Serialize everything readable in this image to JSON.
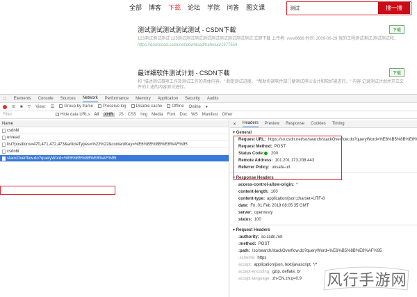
{
  "site": {
    "nav": [
      "全部",
      "博客",
      "下载",
      "论坛",
      "学院",
      "问答",
      "图文课"
    ],
    "nav_active_index": 2,
    "search_value": "测试",
    "search_button": "搜一搜",
    "results": [
      {
        "title": "测试测试测试测试测试 - CSDN下载",
        "snippet": "123测试测试测试 123测试测试测试测试测试测试测试测试测试 立即下载 上传者: vvvv6666 时间: 2009-06-29 我的工程测试测试,测试测试和..",
        "url": "https://download.csdn.net/download/haheiuo/1977654",
        "badge": "下载"
      },
      {
        "title": "最详细软件测试计划 - CSDN下载",
        "snippet": "和 \"描述测试事项工作及测试工作的具体内容。\" 制定测试进度。 \"帮助协调软件部门便测试得以设计和较好被进行。\" 内容 记录测试计划并开立文件的上述的内容测试进行。",
        "url": "",
        "badge": "下载"
      }
    ]
  },
  "devtools": {
    "tabs": [
      "Elements",
      "Console",
      "Sources",
      "Network",
      "Performance",
      "Memory",
      "Application",
      "Security",
      "Audits"
    ],
    "active_tab": "Network",
    "toolbar": {
      "view": "View:",
      "group_by_frame": "Group by frame",
      "preserve_log": "Preserve log",
      "disable_cache": "Disable cache",
      "offline": "Offline",
      "online": "Online"
    },
    "filter": {
      "placeholder": "Filter",
      "hide_data_urls": "Hide data URLs",
      "types": [
        "All",
        "XHR",
        "JS",
        "CSS",
        "Img",
        "Media",
        "Font",
        "Doc",
        "WS",
        "Manifest",
        "Other"
      ],
      "selected_type": "XHR"
    },
    "list_header": "Name",
    "requests": [
      "csdnbi",
      "unread",
      "list?positions=470,471,472,473&articleTypes=%22%22&contentKey=%E6%B5%8B%E8%AF%95",
      "csdnbi",
      "stackOverflow.do?queryWord=%E6%B5%8B%E8%AF%95"
    ],
    "selected_request_index": 4,
    "detail_tabs": [
      "Headers",
      "Preview",
      "Response",
      "Cookies",
      "Timing"
    ],
    "active_detail_tab": "Headers",
    "general": {
      "title": "General",
      "rows": [
        {
          "k": "Request URL:",
          "v": "https://so.csdn.net/so/search/stackOverflow.do?queryWord=%E6%B5%8B%E8%AF%95"
        },
        {
          "k": "Request Method:",
          "v": "POST"
        },
        {
          "k": "Status Code:",
          "v": "200"
        },
        {
          "k": "Remote Address:",
          "v": "101.201.173.208:443"
        },
        {
          "k": "Referrer Policy:",
          "v": "unsafe-url"
        }
      ]
    },
    "response_headers": {
      "title": "Response Headers",
      "rows": [
        {
          "k": "access-control-allow-origin:",
          "v": "*"
        },
        {
          "k": "content-length:",
          "v": "100"
        },
        {
          "k": "content-type:",
          "v": "application/json;charset=UTF-8"
        },
        {
          "k": "date:",
          "v": "Fri, 01 Feb 2019 08:05:35 GMT"
        },
        {
          "k": "server:",
          "v": "openresty"
        },
        {
          "k": "status:",
          "v": "100"
        }
      ]
    },
    "request_headers": {
      "title": "Request Headers",
      "rows": [
        {
          "k": ":authority:",
          "v": "so.csdn.net"
        },
        {
          "k": ":method:",
          "v": "POST"
        },
        {
          "k": ":path:",
          "v": "/so/search/stackOverflow.do?queryWord=%E6%B5%8B%E8%AF%95"
        },
        {
          "k": ":scheme:",
          "v": "https"
        },
        {
          "k": "accept:",
          "v": "application/json, text/javascript, */*"
        },
        {
          "k": "accept-encoding:",
          "v": "gzip, deflate, br"
        },
        {
          "k": "accept-language:",
          "v": "zh-CN,zh;q=0.9"
        }
      ]
    }
  },
  "watermark": "风行手游网",
  "colors": {
    "brand_red": "#ca0c16",
    "highlight_red": "#d9262b",
    "selected_blue": "#3879d9",
    "status_green": "#00aa00"
  }
}
